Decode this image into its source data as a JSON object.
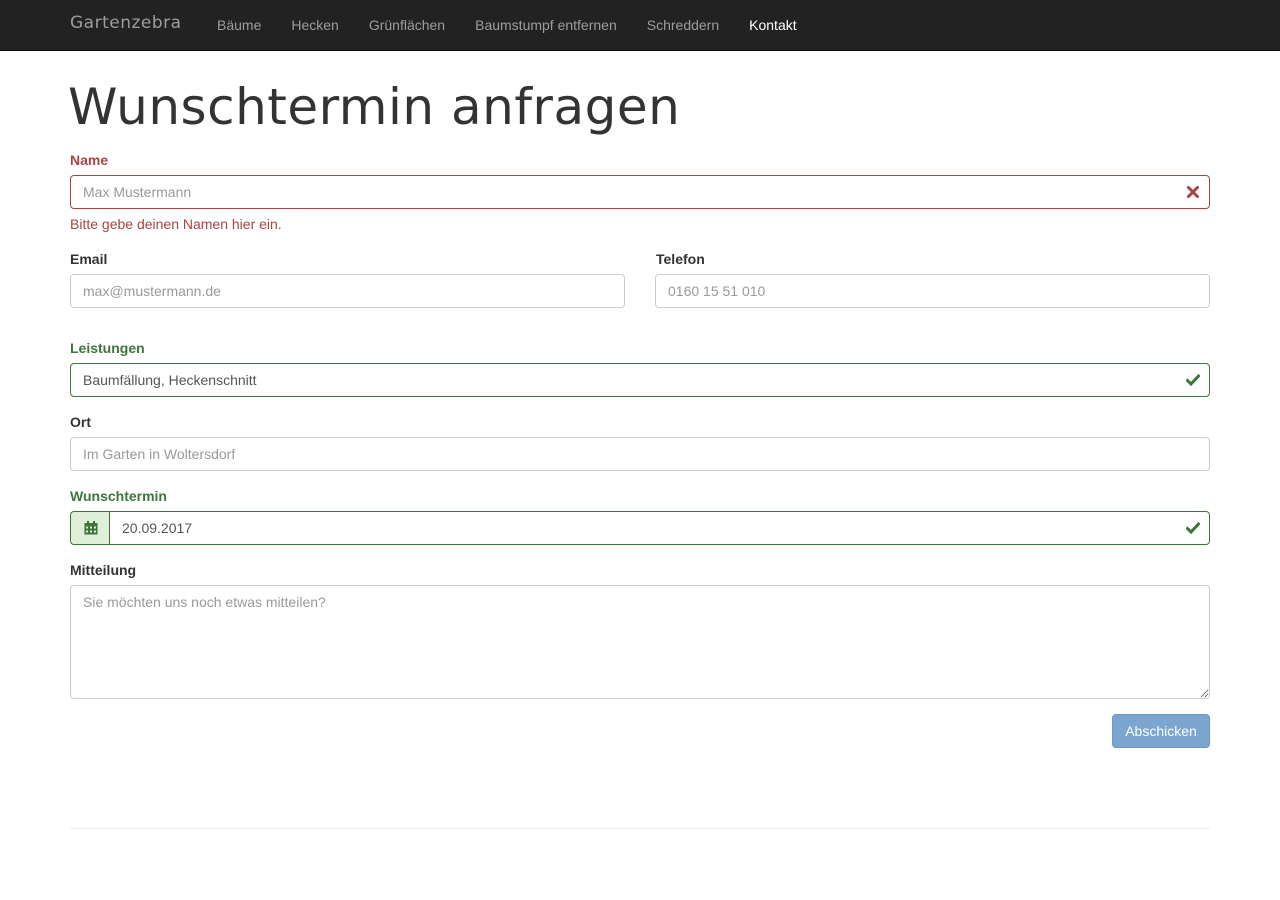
{
  "navbar": {
    "brand": "Gartenzebra",
    "items": [
      {
        "label": "Bäume"
      },
      {
        "label": "Hecken"
      },
      {
        "label": "Grünflächen"
      },
      {
        "label": "Baumstumpf entfernen"
      },
      {
        "label": "Schreddern"
      },
      {
        "label": "Kontakt",
        "active": true
      }
    ]
  },
  "page": {
    "title": "Wunschtermin anfragen"
  },
  "form": {
    "name": {
      "label": "Name",
      "placeholder": "Max Mustermann",
      "value": "",
      "state": "error",
      "help": "Bitte gebe deinen Namen hier ein.",
      "icon": "remove-icon"
    },
    "email": {
      "label": "Email",
      "placeholder": "max@mustermann.de",
      "value": ""
    },
    "telefon": {
      "label": "Telefon",
      "placeholder": "0160 15 51 010",
      "value": ""
    },
    "leistungen": {
      "label": "Leistungen",
      "value": "Baumfällung, Heckenschnitt",
      "state": "success",
      "icon": "check-icon"
    },
    "ort": {
      "label": "Ort",
      "placeholder": "Im Garten in Woltersdorf",
      "value": ""
    },
    "wunschtermin": {
      "label": "Wunschtermin",
      "value": "20.09.2017",
      "state": "success",
      "addon_icon": "calendar-icon",
      "icon": "check-icon"
    },
    "mitteilung": {
      "label": "Mitteilung",
      "placeholder": "Sie möchten uns noch etwas mitteilen?",
      "value": ""
    },
    "submit_label": "Abschicken"
  },
  "colors": {
    "navbar_bg": "#222222",
    "error": "#a94442",
    "success": "#3c763d",
    "success_bg": "#dff0d8",
    "primary_button": "#7aa6d0"
  }
}
